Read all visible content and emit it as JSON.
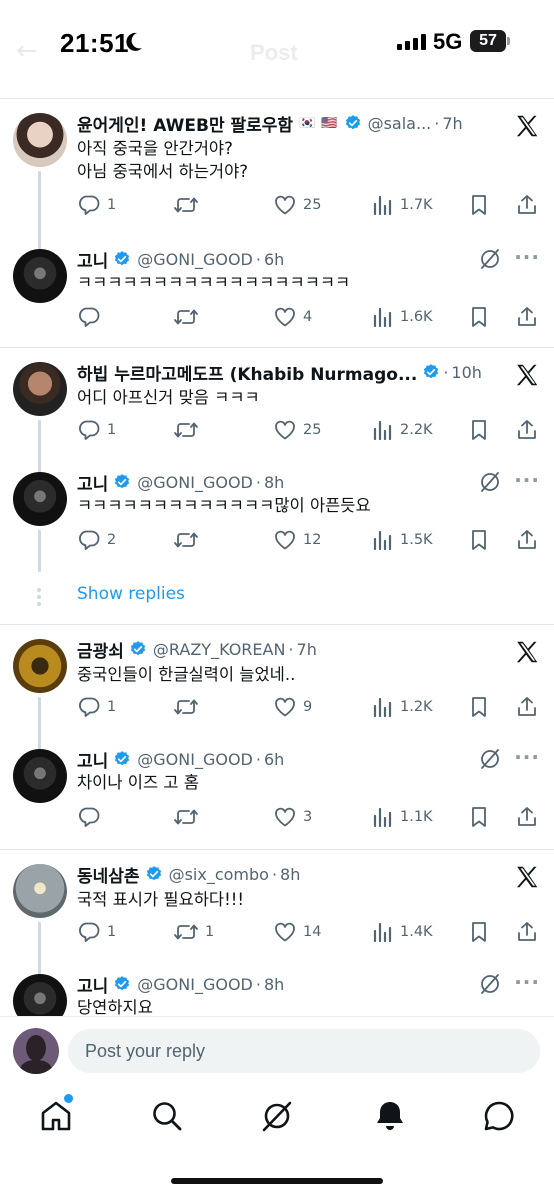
{
  "status_bar": {
    "time": "21:51",
    "network": "5G",
    "battery": "57"
  },
  "header": {
    "title": "Post"
  },
  "threads": [
    {
      "parent": {
        "name": "윤어게인! AWEB만 팔로우함",
        "flags": "🇰🇷 🇺🇸",
        "handle": "@sala...",
        "time": "7h",
        "body": [
          "아직 중국을 안간거야?",
          "아님 중국에서 하는거야?"
        ],
        "replies": "1",
        "reposts": "",
        "likes": "25",
        "views": "1.7K"
      },
      "reply": {
        "name": "고니",
        "handle": "@GONI_GOOD",
        "time": "6h",
        "body": [
          "ㅋㅋㅋㅋㅋㅋㅋㅋㅋㅋㅋㅋㅋㅋㅋㅋㅋㅋ"
        ],
        "replies": "",
        "reposts": "",
        "likes": "4",
        "views": "1.6K"
      }
    },
    {
      "parent": {
        "name": "하빕 누르마고메도프 (Khabib Nurmago...",
        "handle": "",
        "time": "10h",
        "body": [
          "어디 아프신거 맞음 ㅋㅋㅋ"
        ],
        "replies": "1",
        "reposts": "",
        "likes": "25",
        "views": "2.2K"
      },
      "reply": {
        "name": "고니",
        "handle": "@GONI_GOOD",
        "time": "8h",
        "body": [
          "ㅋㅋㅋㅋㅋㅋㅋㅋㅋㅋㅋㅋㅋ많이 아픈듯요"
        ],
        "replies": "2",
        "reposts": "",
        "likes": "12",
        "views": "1.5K"
      },
      "show_replies": "Show replies"
    },
    {
      "parent": {
        "name": "금광쇠",
        "handle": "@RAZY_KOREAN",
        "time": "7h",
        "body": [
          "중국인들이 한글실력이 늘었네.."
        ],
        "replies": "1",
        "reposts": "",
        "likes": "9",
        "views": "1.2K"
      },
      "reply": {
        "name": "고니",
        "handle": "@GONI_GOOD",
        "time": "6h",
        "body": [
          "차이나 이즈 고 홈"
        ],
        "replies": "",
        "reposts": "",
        "likes": "3",
        "views": "1.1K"
      }
    },
    {
      "parent": {
        "name": "동네삼촌",
        "handle": "@six_combo",
        "time": "8h",
        "body": [
          "국적 표시가 필요하다!!!"
        ],
        "replies": "1",
        "reposts": "1",
        "likes": "14",
        "views": "1.4K"
      },
      "reply": {
        "name": "고니",
        "handle": "@GONI_GOOD",
        "time": "8h",
        "body": [
          "당연하지요"
        ]
      }
    }
  ],
  "reply_bar": {
    "placeholder": "Post your reply"
  },
  "nav": [
    "home-icon",
    "search-icon",
    "grok-icon",
    "notifications-icon",
    "messages-icon"
  ],
  "colors": {
    "accent": "#1d9bf0",
    "verified": "#1d9bf0",
    "text": "#0f1419",
    "muted": "#536471",
    "divider": "#e1e6ea"
  }
}
